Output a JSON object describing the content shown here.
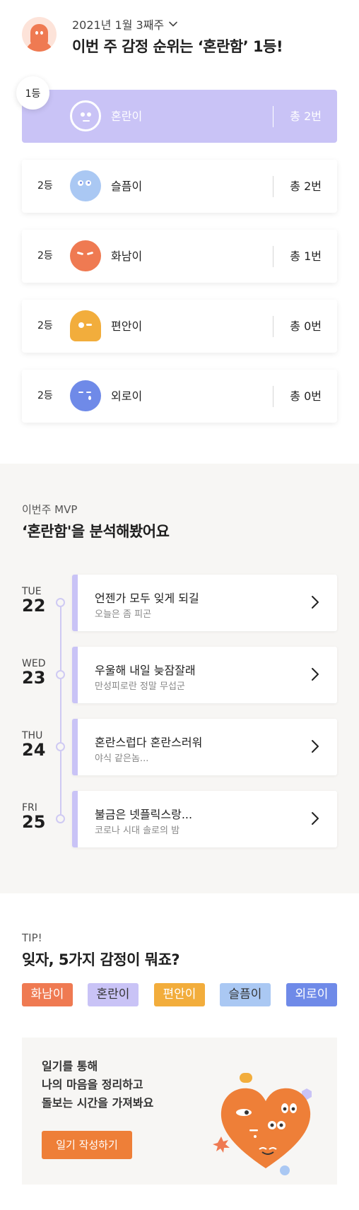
{
  "header": {
    "week_label": "2021년 1월 3째주",
    "headline": "이번 주 감정 순위는 ‘혼란함’ 1등!"
  },
  "ranking": [
    {
      "rank": "1등",
      "name": "혼란이",
      "count": "총 2번",
      "color": "#c9c3f6",
      "icon": "confused-face-icon"
    },
    {
      "rank": "2등",
      "name": "슬픔이",
      "count": "총 2번",
      "color": "#aac8f3",
      "icon": "sad-face-icon"
    },
    {
      "rank": "2등",
      "name": "화남이",
      "count": "총 1번",
      "color": "#ef7a52",
      "icon": "angry-face-icon"
    },
    {
      "rank": "2등",
      "name": "편안이",
      "count": "총 0번",
      "color": "#f2ad3c",
      "icon": "calm-face-icon"
    },
    {
      "rank": "2등",
      "name": "외로이",
      "count": "총 0번",
      "color": "#6f8ae8",
      "icon": "lonely-face-icon"
    }
  ],
  "mvp": {
    "subtitle": "이번주 MVP",
    "title": "‘혼란함'을 분석해봤어요",
    "entries": [
      {
        "dow": "TUE",
        "date": "22",
        "title": "언젠가 모두 잊게 되길",
        "summary": "오늘은 좀 피곤"
      },
      {
        "dow": "WED",
        "date": "23",
        "title": "우울해 내일 늦잠잘래",
        "summary": "만성피로란 정말 무섭군"
      },
      {
        "dow": "THU",
        "date": "24",
        "title": "혼란스럽다 혼란스러워",
        "summary": "야식 같은놈..."
      },
      {
        "dow": "FRI",
        "date": "25",
        "title": "불금은 넷플릭스랑...",
        "summary": "코로나 시대 솔로의 밤"
      }
    ]
  },
  "tip": {
    "label": "TIP!",
    "title": "잊자, 5가지 감정이 뭐죠?",
    "chips": [
      {
        "label": "화남이",
        "bg": "#ef7a52",
        "fg": "#ffffff"
      },
      {
        "label": "혼란이",
        "bg": "#c9c3f6",
        "fg": "#333333"
      },
      {
        "label": "편안이",
        "bg": "#f2ad3c",
        "fg": "#ffffff"
      },
      {
        "label": "슬픔이",
        "bg": "#aac8f3",
        "fg": "#333333"
      },
      {
        "label": "외로이",
        "bg": "#6f8ae8",
        "fg": "#ffffff"
      }
    ]
  },
  "cta": {
    "line1": "일기를 통해",
    "line2": "나의 마음을 정리하고",
    "line3": "돌보는 시간을 가져봐요",
    "button": "일기 작성하기"
  }
}
